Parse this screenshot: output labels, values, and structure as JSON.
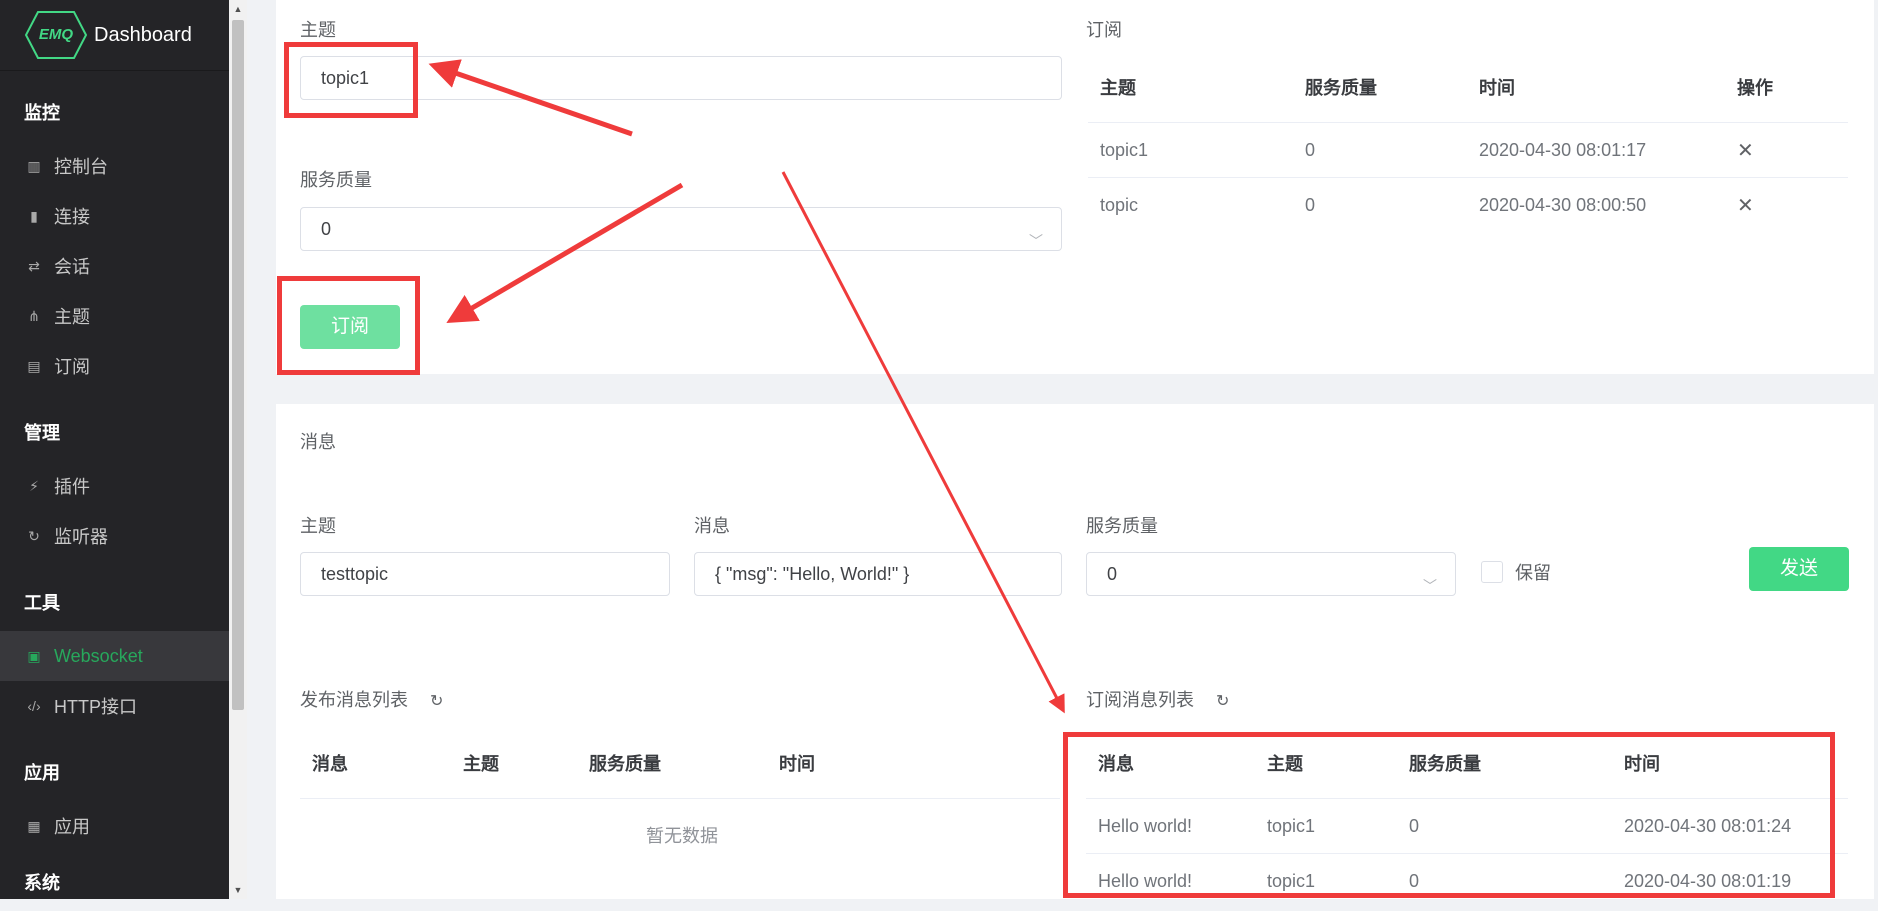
{
  "app": {
    "logo_text": "EMQ",
    "title": "Dashboard"
  },
  "sidebar": {
    "groups": [
      {
        "label": "监控"
      },
      {
        "label": "管理"
      },
      {
        "label": "工具"
      },
      {
        "label": "应用"
      },
      {
        "label": "系统"
      }
    ],
    "items": [
      {
        "label": "控制台",
        "icon": "bar-chart-icon"
      },
      {
        "label": "连接",
        "icon": "chip-icon"
      },
      {
        "label": "会话",
        "icon": "swap-icon"
      },
      {
        "label": "主题",
        "icon": "share-icon"
      },
      {
        "label": "订阅",
        "icon": "rss-icon"
      },
      {
        "label": "插件",
        "icon": "plug-icon"
      },
      {
        "label": "监听器",
        "icon": "refresh-icon"
      },
      {
        "label": "Websocket",
        "icon": "html5-icon",
        "active": true
      },
      {
        "label": "HTTP接口",
        "icon": "code-icon"
      },
      {
        "label": "应用",
        "icon": "archive-icon"
      }
    ]
  },
  "subscribe": {
    "topic_label": "主题",
    "topic_value": "topic1",
    "qos_label": "服务质量",
    "qos_value": "0",
    "button": "订阅",
    "list_title": "订阅",
    "columns": [
      "主题",
      "服务质量",
      "时间",
      "操作"
    ],
    "rows": [
      {
        "topic": "topic1",
        "qos": "0",
        "time": "2020-04-30 08:01:17"
      },
      {
        "topic": "topic",
        "qos": "0",
        "time": "2020-04-30 08:00:50"
      }
    ]
  },
  "message": {
    "title": "消息",
    "topic_label": "主题",
    "topic_value": "testtopic",
    "msg_label": "消息",
    "msg_value": "{ \"msg\": \"Hello, World!\" }",
    "qos_label": "服务质量",
    "qos_value": "0",
    "retain_label": "保留",
    "send_button": "发送",
    "published_title": "发布消息列表",
    "published_columns": [
      "消息",
      "主题",
      "服务质量",
      "时间"
    ],
    "published_empty": "暂无数据",
    "received_title": "订阅消息列表",
    "received_columns": [
      "消息",
      "主题",
      "服务质量",
      "时间"
    ],
    "received_rows": [
      {
        "msg": "Hello world!",
        "topic": "topic1",
        "qos": "0",
        "time": "2020-04-30 08:01:24"
      },
      {
        "msg": "Hello world!",
        "topic": "topic1",
        "qos": "0",
        "time": "2020-04-30 08:01:19"
      }
    ]
  },
  "colors": {
    "accent": "#42d885",
    "annotation": "#ef3b3b",
    "sidebar_bg": "#242427"
  }
}
